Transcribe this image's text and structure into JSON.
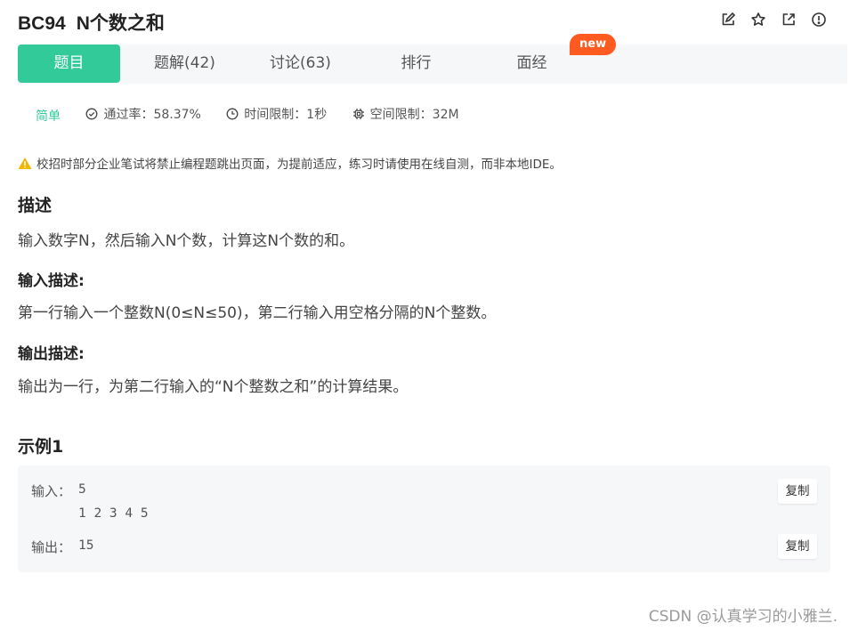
{
  "problem": {
    "id": "BC94",
    "name": "N个数之和"
  },
  "tabs": [
    {
      "label": "题目"
    },
    {
      "label": "题解(42)"
    },
    {
      "label": "讨论(63)"
    },
    {
      "label": "排行"
    },
    {
      "label": "面经"
    }
  ],
  "new_badge": "new",
  "meta": {
    "difficulty": "简单",
    "pass_rate": "通过率：58.37%",
    "time_limit": "时间限制：1秒",
    "memory_limit": "空间限制：32M"
  },
  "warning": "校招时部分企业笔试将禁止编程题跳出页面，为提前适应，练习时请使用在线自测，而非本地IDE。",
  "description": {
    "heading": "描述",
    "text": "输入数字N，然后输入N个数，计算这N个数的和。"
  },
  "input_desc": {
    "heading": "输入描述:",
    "text": "第一行输入一个整数N(0≤N≤50)，第二行输入用空格分隔的N个整数。"
  },
  "output_desc": {
    "heading": "输出描述:",
    "text": "输出为一行，为第二行输入的“N个整数之和”的计算结果。"
  },
  "example": {
    "heading": "示例1",
    "input_label": "输入：",
    "input_value": "5\n1 2 3 4 5",
    "output_label": "输出：",
    "output_value": "15",
    "copy_label": "复制"
  },
  "watermark": "CSDN @认真学习的小雅兰.",
  "colors": {
    "accent": "#32ca99",
    "badge": "#ff5a1f",
    "warning": "#f5b400"
  }
}
